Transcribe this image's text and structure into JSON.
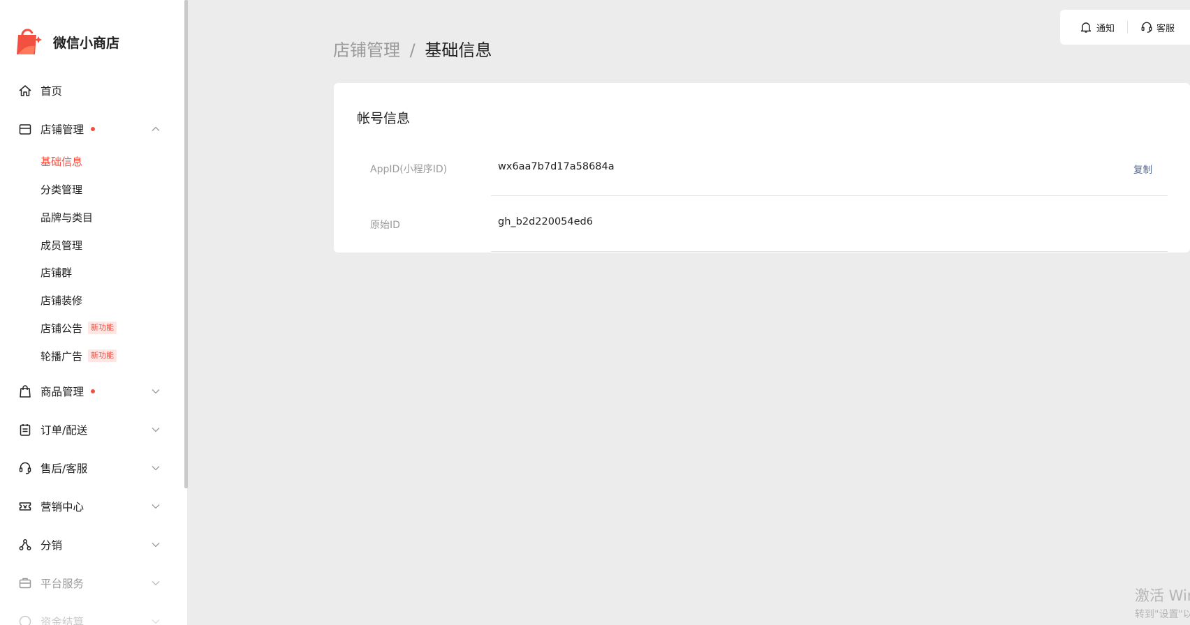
{
  "app": {
    "name": "微信小商店",
    "brand_color": "#f25041",
    "link_color": "#576b95"
  },
  "sidebar": {
    "home": {
      "label": "首页",
      "icon": "home-icon"
    },
    "store": {
      "label": "店铺管理",
      "icon": "store-icon",
      "dot": true,
      "expanded": true,
      "children": [
        {
          "label": "基础信息",
          "active": true
        },
        {
          "label": "分类管理"
        },
        {
          "label": "品牌与类目"
        },
        {
          "label": "成员管理"
        },
        {
          "label": "店铺群"
        },
        {
          "label": "店铺装修"
        },
        {
          "label": "店铺公告",
          "badge": "新功能"
        },
        {
          "label": "轮播广告",
          "badge": "新功能"
        }
      ]
    },
    "products": {
      "label": "商品管理",
      "icon": "shopping-bag-icon",
      "dot": true
    },
    "orders": {
      "label": "订单/配送",
      "icon": "clipboard-icon"
    },
    "aftersales": {
      "label": "售后/客服",
      "icon": "headset-icon"
    },
    "marketing": {
      "label": "营销中心",
      "icon": "ticket-icon"
    },
    "distribution": {
      "label": "分销",
      "icon": "share-nodes-icon"
    },
    "platform": {
      "label": "平台服务",
      "icon": "briefcase-icon"
    },
    "funds": {
      "label": "资金结算",
      "icon": "money-icon"
    }
  },
  "header": {
    "breadcrumb": {
      "parent": "店铺管理",
      "separator": "/",
      "current": "基础信息"
    },
    "notify_label": "通知",
    "service_label": "客服"
  },
  "account_card": {
    "title": "帐号信息",
    "rows": [
      {
        "key": "AppID(小程序ID)",
        "value": "wx6aa7b7d17a58684a",
        "action": "复制"
      },
      {
        "key": "原始ID",
        "value": "gh_b2d220054ed6"
      }
    ]
  },
  "watermark": {
    "line1": "激活 Win",
    "line2": "转到\"设置\"以"
  }
}
